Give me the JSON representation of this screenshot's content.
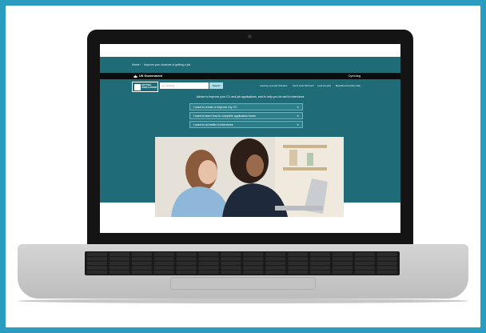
{
  "breadcrumb": {
    "home": "Home",
    "separator": "›",
    "current": "Improve your chances of getting a job"
  },
  "gov_bar": {
    "name": "UK Government",
    "language": "Cymraeg"
  },
  "header": {
    "logo_text_line1": "GETTING",
    "logo_text_line2": "JOBS FASTER",
    "search_placeholder": "e.g. Nursing",
    "search_button": "Search",
    "nav": [
      {
        "label": "Improve your job chances"
      },
      {
        "label": "Can't work full time?"
      },
      {
        "label": "Look for jobs"
      },
      {
        "label": "Benefits and other help"
      }
    ]
  },
  "main": {
    "intro": "Advice to improve your CV and job applications, and to help you do well in interviews",
    "choices": [
      {
        "label": "I want to create or improve my CV",
        "arrow": "➔"
      },
      {
        "label": "I want to learn how to complete application forms",
        "arrow": "➔"
      },
      {
        "label": "I want to do better in interviews",
        "arrow": "➔"
      }
    ]
  },
  "colors": {
    "frame": "#2a9cc0",
    "teal": "#1f6b78",
    "gov_black": "#0b0c0c",
    "search_button": "#a8dde7"
  }
}
